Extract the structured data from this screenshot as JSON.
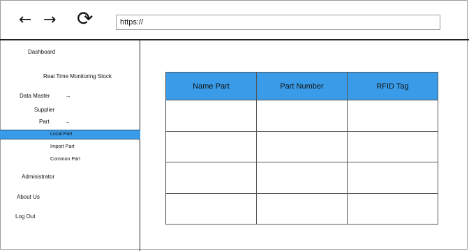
{
  "browser": {
    "back_icon": "←",
    "forward_icon": "→",
    "reload_icon": "⟳",
    "url": "https://"
  },
  "sidebar": {
    "dashboard": "Dashboard",
    "real_time": "Real Time Monitoring Stock",
    "data_master": "Data Master",
    "data_master_arrow": "→",
    "supplier": "Supplier",
    "part": "Part",
    "part_arrow": "→",
    "local_part": "Local Part",
    "import_part": "Import Part",
    "common_part": "Common Part",
    "administrator": "Administrator",
    "about_us": "About Us",
    "log_out": "Log Out"
  },
  "colors": {
    "accent": "#3a9ce8"
  },
  "table": {
    "headers": [
      "Name Part",
      "Part Number",
      "RFID Tag"
    ],
    "rows": [
      [
        "",
        "",
        ""
      ],
      [
        "",
        "",
        ""
      ],
      [
        "",
        "",
        ""
      ],
      [
        "",
        "",
        ""
      ]
    ]
  }
}
